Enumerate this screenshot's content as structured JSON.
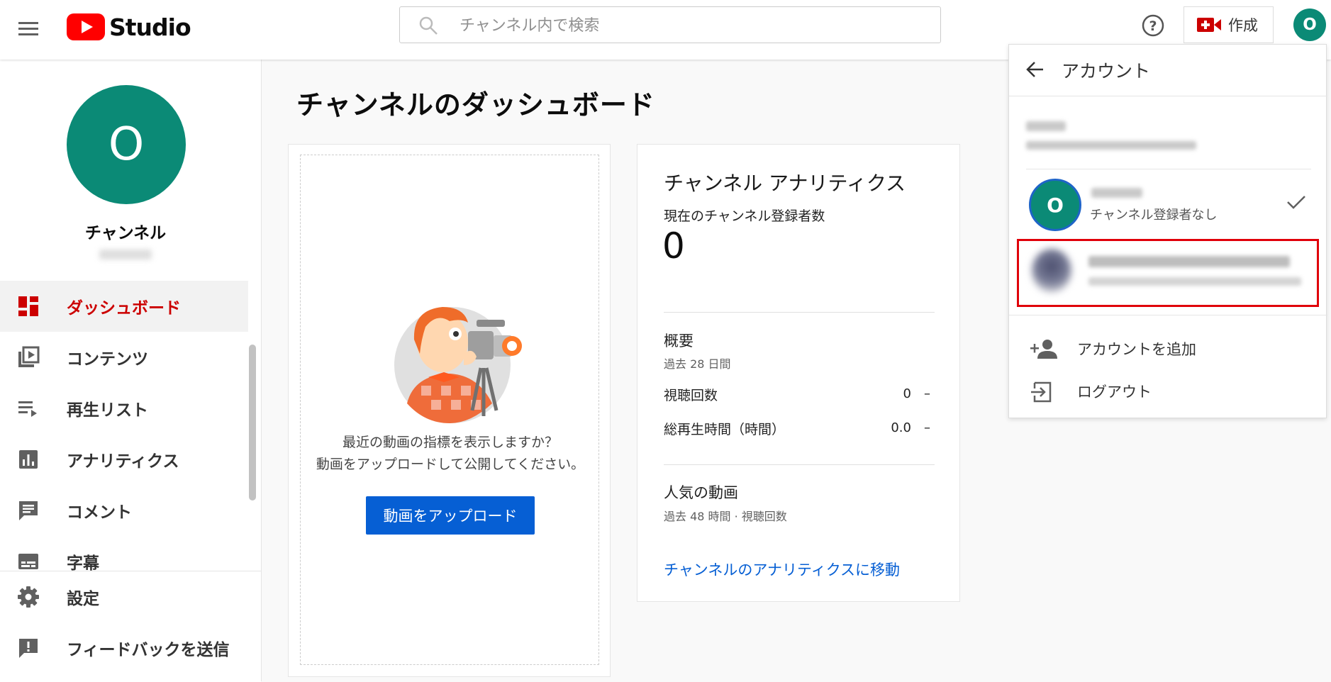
{
  "app": {
    "logo_text": "Studio",
    "brand_color": "#ff0000",
    "accent_color": "#065fd4"
  },
  "header": {
    "search_placeholder": "チャンネル内で検索",
    "create_label": "作成",
    "avatar_initial": "O"
  },
  "sidebar": {
    "avatar_initial": "O",
    "channel_name": "チャンネル",
    "items": [
      {
        "label": "ダッシュボード",
        "icon": "dashboard-icon",
        "active": true
      },
      {
        "label": "コンテンツ",
        "icon": "content-icon"
      },
      {
        "label": "再生リスト",
        "icon": "playlist-icon"
      },
      {
        "label": "アナリティクス",
        "icon": "analytics-icon"
      },
      {
        "label": "コメント",
        "icon": "comment-icon"
      },
      {
        "label": "字幕",
        "icon": "subtitles-icon"
      }
    ],
    "bottom_items": [
      {
        "label": "設定",
        "icon": "gear-icon"
      },
      {
        "label": "フィードバックを送信",
        "icon": "feedback-icon"
      }
    ]
  },
  "main": {
    "title": "チャンネルのダッシュボード",
    "upload_card": {
      "prompt_line1": "最近の動画の指標を表示しますか？",
      "prompt_line2": "動画をアップロードして公開してください。",
      "upload_button": "動画をアップロード"
    },
    "analytics_card": {
      "title": "チャンネル アナリティクス",
      "subscribers_label": "現在のチャンネル登録者数",
      "subscribers_count": "0",
      "summary_heading": "概要",
      "summary_period": "過去 28 日間",
      "metrics": [
        {
          "label": "視聴回数",
          "value": "0",
          "change": "–"
        },
        {
          "label": "総再生時間（時間）",
          "value": "0.0",
          "change": "–"
        }
      ],
      "popular_heading": "人気の動画",
      "popular_period": "過去 48 時間 · 視聴回数",
      "link": "チャンネルのアナリティクスに移動"
    }
  },
  "account_panel": {
    "title": "アカウント",
    "current_account_initial": "O",
    "current_account_subtext": "チャンネル登録者なし",
    "add_account": "アカウントを追加",
    "logout": "ログアウト",
    "highlight_color": "#e0000a"
  }
}
